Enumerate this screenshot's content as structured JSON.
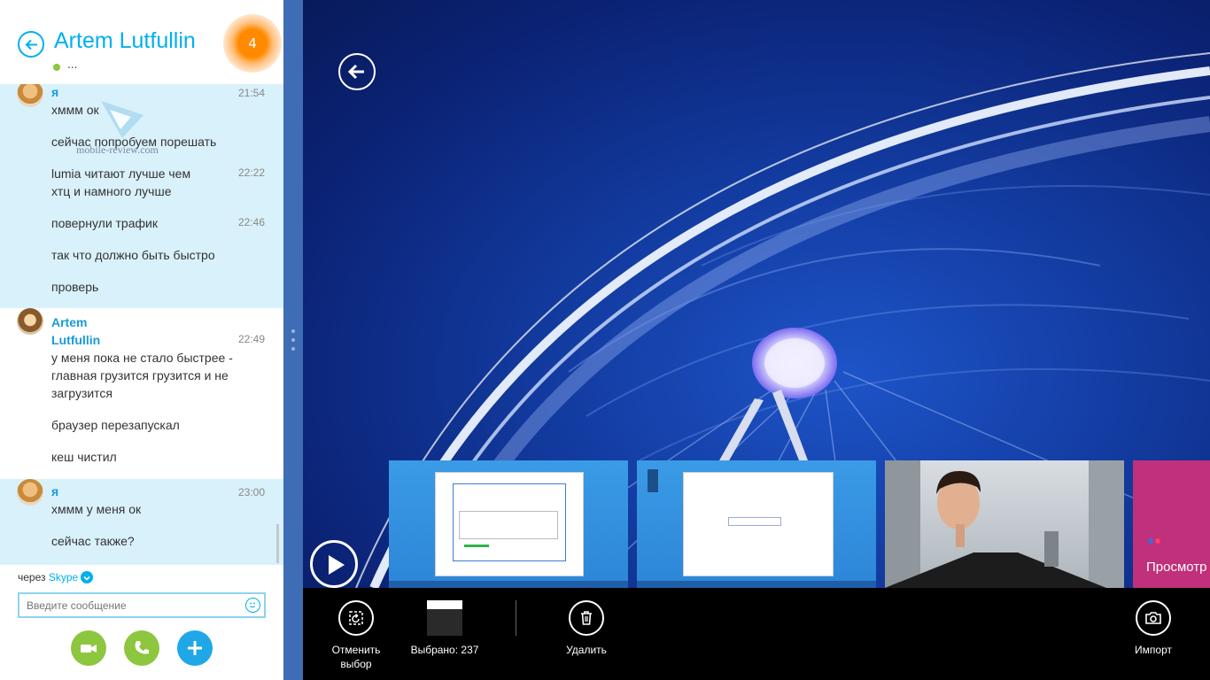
{
  "skype": {
    "contact_name": "Artem Lutfullin",
    "status_text": "...",
    "notification_count": "4",
    "via_prefix": "через",
    "via_service": "Skype",
    "input_placeholder": "Введите сообщение",
    "watermark": "mobile-review.com",
    "messages": [
      {
        "sender": "я",
        "side": "mine",
        "lines": [
          {
            "text": "хммм ок",
            "time": "21:54"
          },
          {
            "text": "сейчас попробуем порешать",
            "time": ""
          },
          {
            "text": "lumia читают лучше чем хтц и намного лучше",
            "time": "22:22"
          },
          {
            "text": "повернули трафик",
            "time": "22:46"
          },
          {
            "text": "так что должно быть быстро",
            "time": ""
          },
          {
            "text": "проверь",
            "time": ""
          }
        ]
      },
      {
        "sender": "Artem Lutfullin",
        "side": "theirs",
        "lines": [
          {
            "text": "у меня пока не стало быстрее - главная грузится грузится и не загрузится",
            "time": "22:49"
          },
          {
            "text": "браузер перезапускал",
            "time": ""
          },
          {
            "text": "кеш чистил",
            "time": ""
          }
        ]
      },
      {
        "sender": "я",
        "side": "mine",
        "lines": [
          {
            "text": "хммм у меня ок",
            "time": "23:00"
          },
          {
            "text": "сейчас также?",
            "time": ""
          }
        ]
      }
    ]
  },
  "photos": {
    "pink_tile_label": "Просмотр",
    "appbar": {
      "clear_selection": "Отменить выбор",
      "selected": "Выбрано: 237",
      "delete": "Удалить",
      "import": "Импорт"
    }
  },
  "colors": {
    "skype_blue": "#00aff0",
    "my_message_bg": "#d9f1fb",
    "notification_orange": "#ff8a00",
    "video_green": "#8dc63f",
    "splitter": "#3e6db5",
    "pink_tile": "#c1307a"
  },
  "icons": [
    "back-arrow-icon",
    "video-call-icon",
    "phone-icon",
    "plus-icon",
    "smiley-icon",
    "play-icon",
    "clear-selection-icon",
    "trash-icon",
    "camera-import-icon",
    "chevron-down-icon"
  ]
}
